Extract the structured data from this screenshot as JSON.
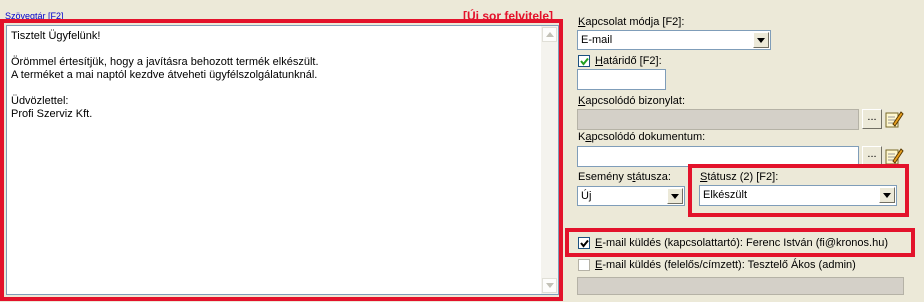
{
  "editor": {
    "label": "Szövegtár [F2]",
    "new_row_label": "[Új sor felvitele]",
    "lines": [
      "Tisztelt Ügyfelünk!",
      "",
      "Örömmel értesítjük, hogy a javításra behozott termék elkészült.",
      "A terméket a mai naptól kezdve átveheti ügyfélszolgálatunknál.",
      "",
      "Üdvözlettel:",
      "Profi Szerviz Kft."
    ]
  },
  "contact_mode": {
    "label": "Kapcsolat módja [F2]:",
    "value": "E-mail"
  },
  "deadline": {
    "label": "Határidő [F2]:",
    "checked": true,
    "value": ""
  },
  "related_document": {
    "label": "Kapcsolódó bizonylat:",
    "value": "",
    "browse_label": "..."
  },
  "related_file": {
    "label": "Kapcsolódó dokumentum:",
    "value": "",
    "browse_label": "..."
  },
  "event_status": {
    "label": "Esemény státusza:",
    "value": "Új"
  },
  "status": {
    "label": "Státusz (2) [F2]:",
    "value": "Elkészült"
  },
  "email_contact": {
    "label": "E-mail küldés (kapcsolattartó): Ferenc István (fi@kronos.hu)",
    "checked": true
  },
  "email_responsible": {
    "label": "E-mail küldés (felelős/címzett): Tesztelő Ákos (admin)",
    "checked": false
  },
  "colors": {
    "highlight": "#e3122b",
    "link": "#0000cc"
  }
}
